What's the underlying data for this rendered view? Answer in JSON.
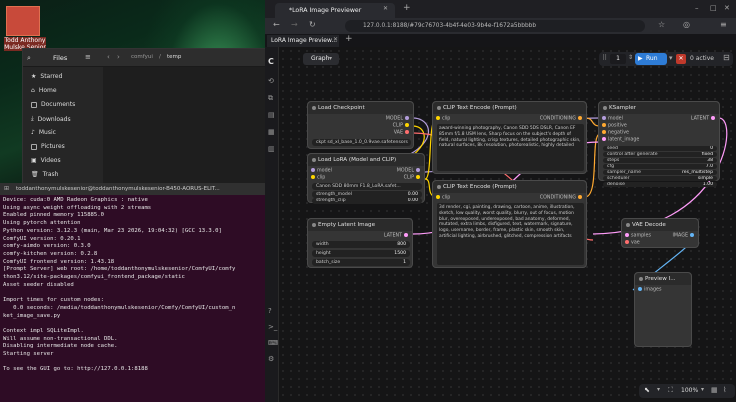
{
  "desktop": {
    "user_name": "Todd Anthony Mulske Senior"
  },
  "files": {
    "title": "Files",
    "path_parent": "comfyui",
    "path_current": "temp",
    "sidebar": [
      "Starred",
      "Home",
      "Documents",
      "Downloads",
      "Music",
      "Pictures",
      "Videos",
      "Trash"
    ]
  },
  "terminal": {
    "title": "toddanthonymulskesenior@toddanthonymulskesenior-B450-AORUS-ELIT...",
    "lines": [
      "Device: cuda:0 AMD Radeon Graphics : native",
      "Using async weight offloading with 2 streams",
      "Enabled pinned memory 115885.0",
      "Using pytorch attention",
      "Python version: 3.12.3 (main, Mar 23 2026, 19:04:32) [GCC 13.3.0]",
      "ComfyUI version: 0.20.1",
      "comfy-aimdo version: 0.3.0",
      "comfy-kitchen version: 0.2.8",
      "ComfyUI frontend version: 1.43.18",
      "[Prompt Server] web root: /home/toddanthonymulskesenior/ComfyUI/comfy",
      "thon3.12/site-packages/comfyui_frontend_package/static",
      "Asset seeder disabled",
      "",
      "Import times for custom nodes:",
      "   0.0 seconds: /media/toddanthonymulskesenior/Comfy/ComfyUI/custom_n",
      "ket_image_save.py",
      "",
      "Context impl SQLiteImpl.",
      "Will assume non-transactional DDL.",
      "Disabling intermediate node cache.",
      "Starting server",
      "",
      "To see the GUI go to: http://127.0.0.1:8188"
    ]
  },
  "browser": {
    "tab_title": "*LoRA Image Previewer",
    "url": "127.0.0.1:8188/#79c76703-4b4f-4e03-9b4e-f1672a5bbbbb",
    "app_tab": "LoRA Image Preview...",
    "graph_label": "Graph",
    "queue_count": "1",
    "run_label": "Run",
    "active_label": "0 active",
    "zoom": "100%"
  },
  "nodes": {
    "load_checkpoint": {
      "title": "Load Checkpoint",
      "outputs": [
        "MODEL",
        "CLIP",
        "VAE"
      ],
      "ckpt": "sd_xl_base_1.0_0.9vae.safetensors",
      "ckpt_label": "ckpt"
    },
    "load_lora": {
      "title": "Load LoRA (Model and CLIP)",
      "inputs": [
        "model",
        "clip"
      ],
      "outputs": [
        "MODEL",
        "CLIP"
      ],
      "lora": "Canon SDD 80mm F1.8_LoRA.safet...",
      "strength_model_label": "strength_model",
      "strength_model": "0.00",
      "strength_clip_label": "strength_clip",
      "strength_clip": "0.00"
    },
    "clip_pos": {
      "title": "CLIP Text Encode (Prompt)",
      "input": "clip",
      "output": "CONDITIONING",
      "text": "award-winning photography, Canon SDD 5DS DSLR, Canon EF 85mm f/1.8 USM lens, Sharp focus on the subject's depth of field, natural lighting, crisp textures, detailed photographic skin, natural surfaces, 8k resolution, photorealistic, highly detailed"
    },
    "clip_neg": {
      "title": "CLIP Text Encode (Prompt)",
      "input": "clip",
      "output": "CONDITIONING",
      "text": "3d render, cgi, painting, drawing, cartoon, anime, illustration, sketch, low quality, worst quality, blurry, out of focus, motion blur, overexposed, underexposed, bad anatomy, deformed, mutated, extra limbs, disfigured, text, watermark, signature, logo, username, border, frame, plastic skin, smooth skin, artificial lighting, airbrushed, glitched, compression artifacts"
    },
    "empty_latent": {
      "title": "Empty Latent Image",
      "output": "LATENT",
      "width_label": "width",
      "width": "800",
      "height_label": "height",
      "height": "1500",
      "batch_label": "batch_size",
      "batch": "1"
    },
    "ksampler": {
      "title": "KSampler",
      "inputs": [
        "model",
        "positive",
        "negative",
        "latent_image"
      ],
      "output": "LATENT",
      "fields": [
        [
          "seed",
          "0"
        ],
        [
          "control after generate",
          "fixed"
        ],
        [
          "steps",
          "38"
        ],
        [
          "cfg",
          "7.0"
        ],
        [
          "sampler_name",
          "res_multistep"
        ],
        [
          "scheduler",
          "simple"
        ],
        [
          "denoise",
          "1.00"
        ]
      ]
    },
    "vae_decode": {
      "title": "VAE Decode",
      "inputs": [
        "samples",
        "vae"
      ],
      "output": "IMAGE"
    },
    "preview": {
      "title": "Preview I...",
      "input": "images"
    }
  },
  "colors": {
    "model": "#b39ddb",
    "clip": "#ffd500",
    "vae": "#ff6e6e",
    "conditioning": "#ffa931",
    "latent": "#ff9cf9",
    "image": "#64b5f6",
    "run": "#2e7cd6"
  }
}
